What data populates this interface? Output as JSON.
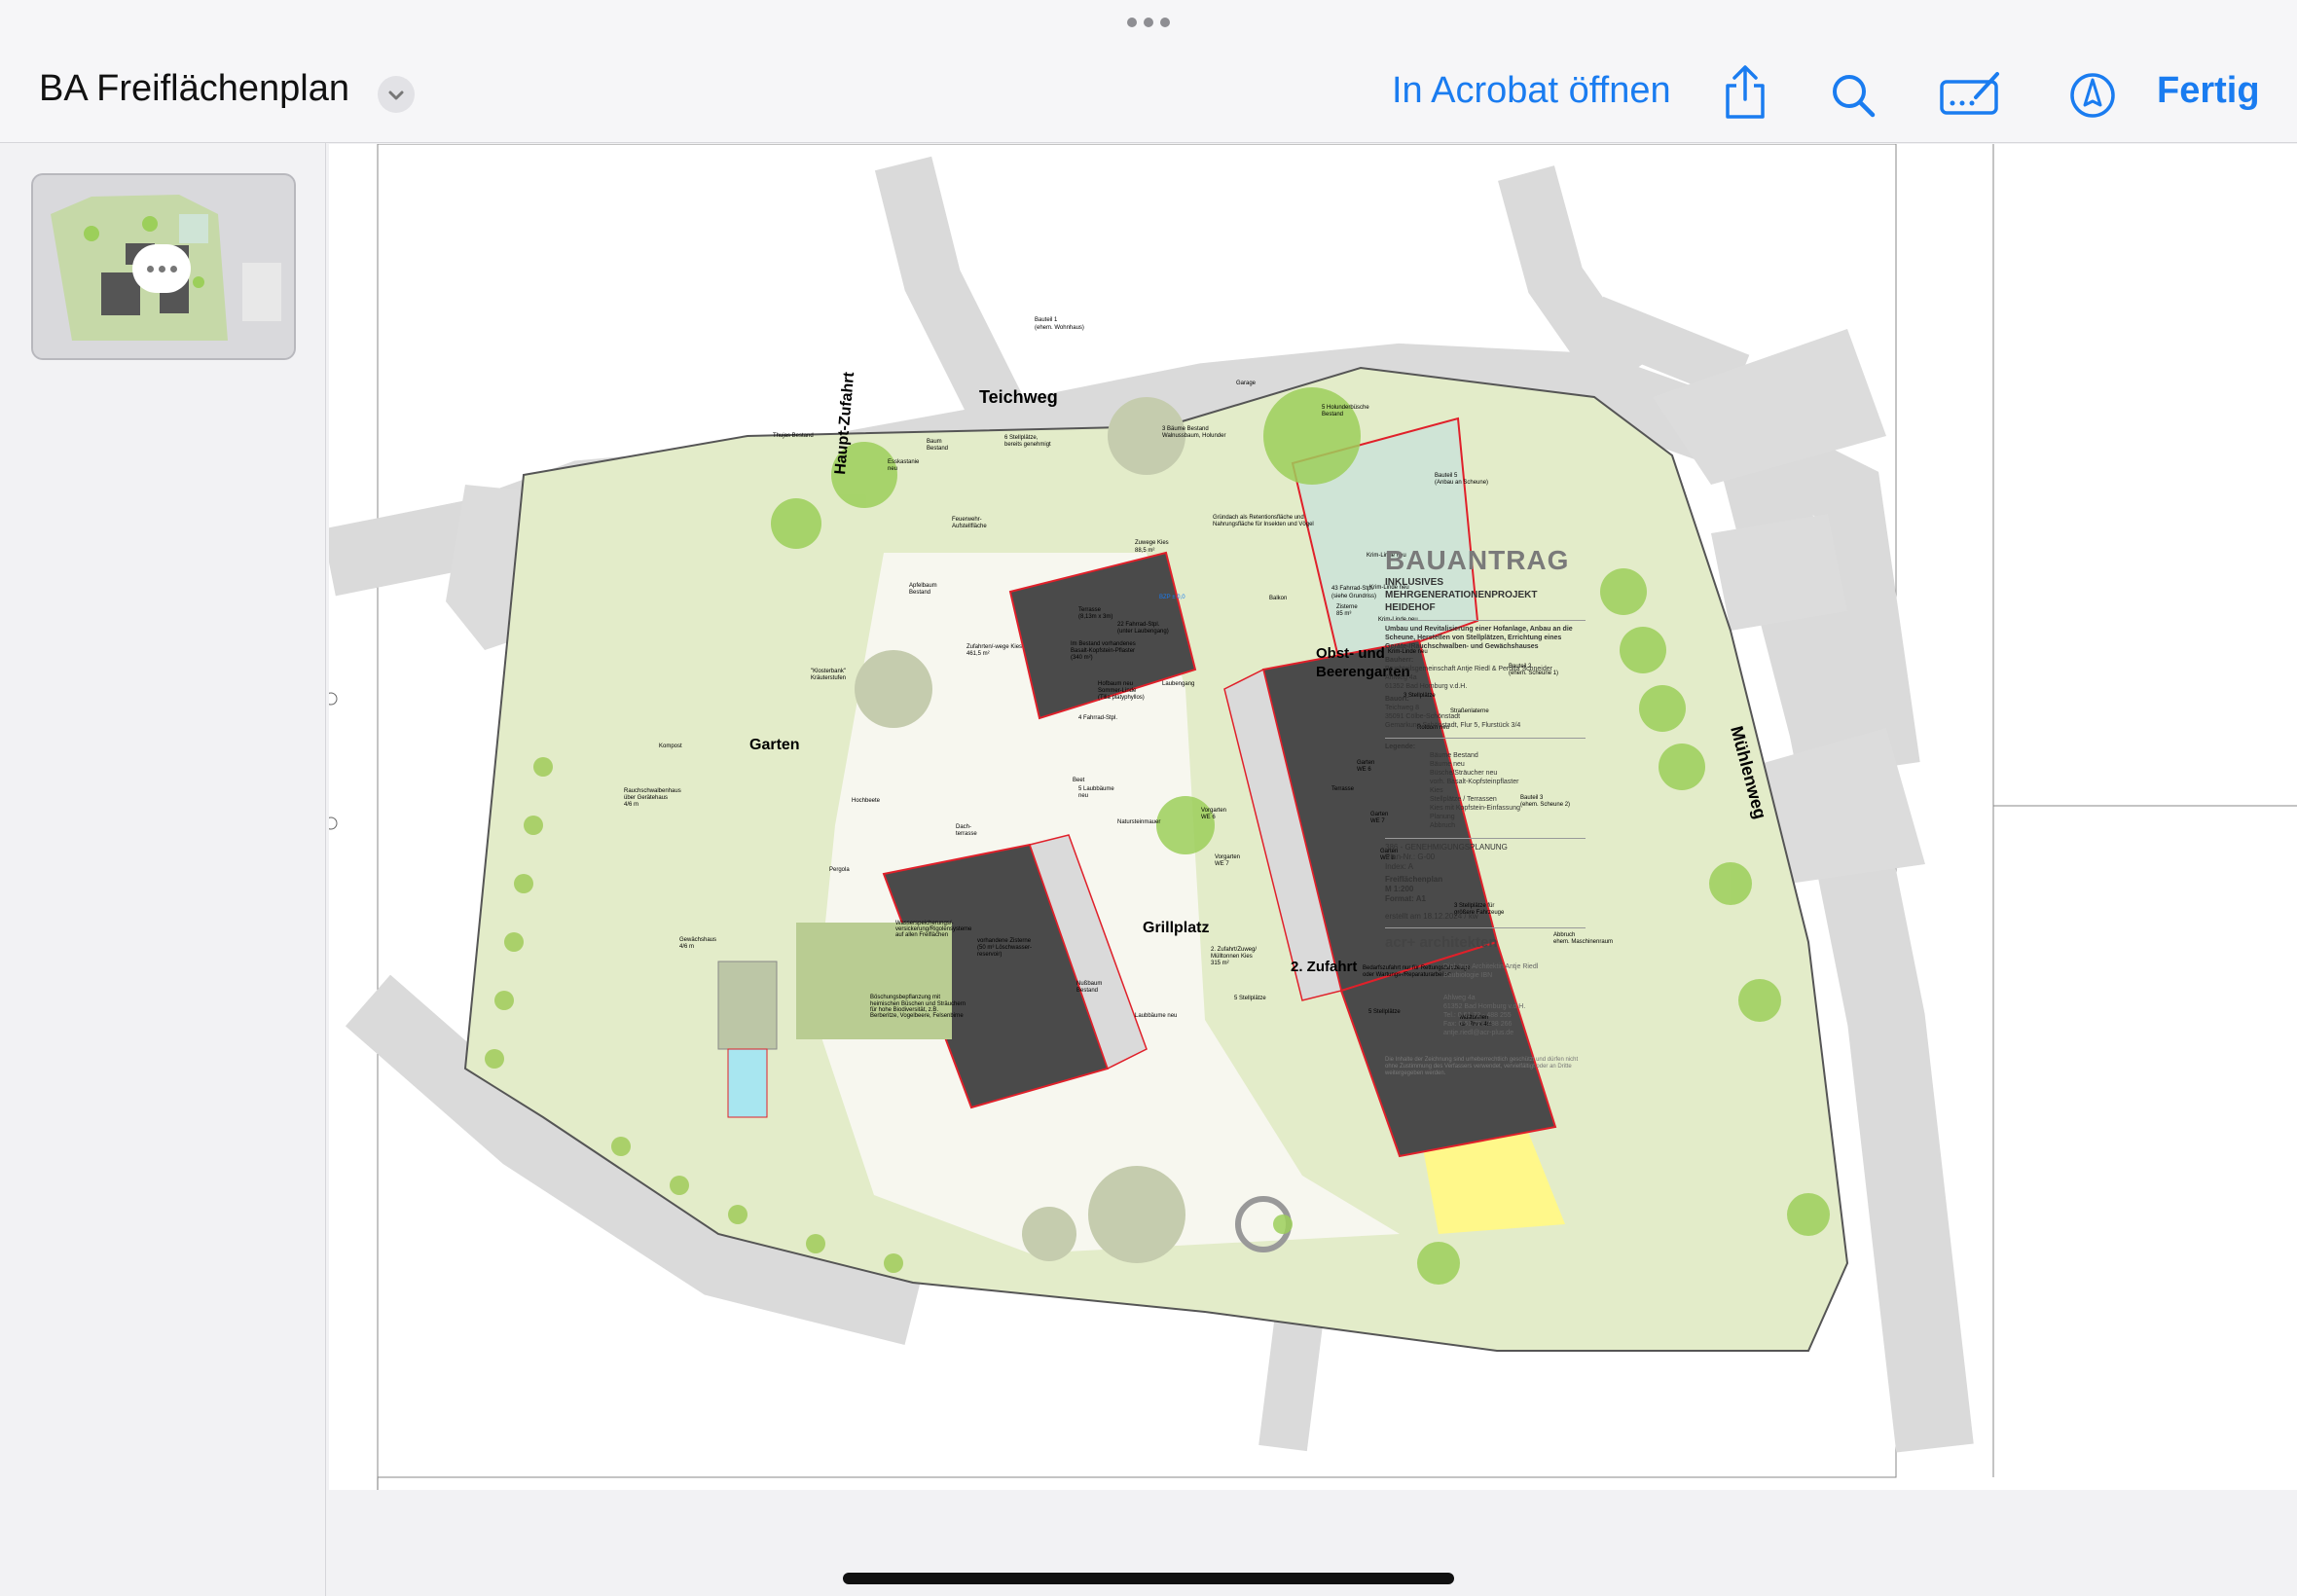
{
  "toolbar": {
    "title": "BA Freiflächenplan",
    "open_in_acrobat": "In Acrobat öffnen",
    "done": "Fertig"
  },
  "colors": {
    "accent": "#1a7cf0",
    "roof": "#4a4a4a",
    "lawn": "#e3ecc9",
    "tree": "#9ccf5a",
    "road": "#dcdcdc",
    "green_roof": "#cfe4d6",
    "gravel": "#fff88a",
    "planning_red": "#e0202a"
  },
  "icons": [
    "chevron-down-icon",
    "share-icon",
    "search-icon",
    "annotate-icon",
    "markup-pen-icon",
    "more-icon"
  ],
  "plan": {
    "labels": {
      "teichweg": "Teichweg",
      "haupt_zufahrt": "Haupt-Zufahrt",
      "muehlenweg": "Mühlenweg",
      "garten": "Garten",
      "obst_beeren_1": "Obst- und",
      "obst_beeren_2": "Beerengarten",
      "grillplatz": "Grillplatz",
      "zufahrt2": "2. Zufahrt",
      "bauteil1": "Bauteil 1",
      "bauteil1_sub": "(ehem. Wohnhaus)",
      "bauteil5": "Bauteil 5",
      "bauteil5_sub": "(Anbau an Scheune)",
      "bauteil2": "Bauteil 2",
      "bauteil2_sub": "(ehem. Scheune 1)",
      "bauteil3": "Bauteil 3",
      "bauteil3_sub": "(ehem. Scheune 2)",
      "stellplaetze6": "6 Stellplätze,",
      "stellplaetze6_sub": "bereits genehmigt",
      "feuerwehr": "Feuerwehr-",
      "feuerwehr_sub": "Aufstellfläche",
      "gruendach": "Gründach als Retentionsfläche und",
      "gruendach_sub": "Nahrungsfläche für Insekten und Vögel",
      "fahrrad43": "43 Fahrrad-Stpl.",
      "fahrrad43_sub": "(siehe Grundriss)",
      "zisterne": "Zisterne",
      "zisterne_sub": "85 m³",
      "zuwege": "Zuwege Kies",
      "zuwege_sub": "88,5 m²",
      "zufahrten": "Zufahrten/-wege Kies",
      "zufahrten_sub": "461,5 m²",
      "klosterbank": "\"Klosterbank\"",
      "klosterbank_sub": "Kräuterstufen",
      "kompost": "Kompost",
      "rauchschwalben": "Rauchschwalbenhaus",
      "rauchschwalben_sub": "über Gerätehaus",
      "rauchschwalben_sub2": "4/6 m",
      "gewaechshaus": "Gewächshaus",
      "gewaechshaus_sub": "4/6 m",
      "hochbeete": "Hochbeete",
      "pergola": "Pergola",
      "wasser": "Wasserspeicherungs/-",
      "wasser_sub": "versickerung/Rigolensysteme",
      "wasser_sub2": "auf allen Freiflächen",
      "zisterne_v": "vorhandene Zisterne",
      "zisterne_v_sub": "(50 m³ Löschwasser-",
      "zisterne_v_sub2": "reservoir)",
      "nussbaum": "Nußbaum",
      "nussbaum_sub": "Bestand",
      "boeschung": "Böschungsbepflanzung mit",
      "boeschung_sub": "heimischen Büschen und Sträuchern",
      "boeschung_sub2": "für hohe Biodiversität, z.B.",
      "boeschung_sub3": "Berberitze, Vogelbeere, Felsenbirne",
      "laubbaeume": "Laubbäume neu",
      "abbruch": "Abbruch",
      "abbruch_sub": "ehem. Maschinenraum",
      "muelltonnen": "Mülltonnen",
      "muelltonnen_sub": "ca. 7m x 4m",
      "bedarf": "Bedarfszufahrt nur für Rettungsfahrzeuge",
      "bedarf_sub": "oder Wartungs-/Reparaturarbeiten",
      "zuweg2": "2. Zufahrt/Zuweg/",
      "zuweg2_sub": "Mülltonnen Kies",
      "zuweg2_sub2": "315 m²",
      "krim1": "Krim-Linde neu",
      "krim2": "Krim-Linde neu",
      "krim3": "Krim-Linde neu",
      "krim4": "Krim-Linde neu",
      "rotdorn": "Rotdorn neu",
      "esskastanie": "Esskastanie",
      "esskastanie_sub": "neu",
      "apfelbaum": "Apfelbaum",
      "apfelbaum_sub": "Bestand",
      "thujas": "Thujas Bestand",
      "holunder": "5 Holunderbüsche",
      "holunder_sub": "Bestand",
      "bestand3": "3 Bäume Bestand",
      "bestand3_sub": "Walnussbaum, Holunder",
      "stpl5": "5 Stellplätze",
      "stpl3": "3 Stellplätze",
      "strassenlaterne": "Straßenlaterne",
      "fahrrad22": "22 Fahrrad-Stpl.",
      "fahrrad22_sub": "(unter Laubengang)",
      "fahrrad4": "4 Fahrrad-Stpl.",
      "pflaster": "Im Bestand vorhandenes",
      "pflaster_sub": "Basalt-Kopfstein-Pflaster",
      "pflaster_sub2": "(340 m²)",
      "hofbaum": "Hofbaum neu",
      "hofbaum_sub": "Sommer-Linde",
      "hofbaum_sub2": "(Tilia platyphyllos)",
      "laubengang": "Laubengang",
      "balkon": "Balkon",
      "terrasse": "Terrasse",
      "terrasse_main": "Terrasse",
      "terrasse_main_sub": "(8,13m x 3m)",
      "dachterrasse": "Dach-",
      "dachterrasse_sub": "terrasse",
      "beet": "Beet",
      "laubbaeume5": "5 Laubbäume",
      "laubbaeume5_sub": "neu",
      "naturstein": "Natursteinmauer",
      "garten6": "Garten",
      "garten6_sub": "WE 6",
      "garten7": "Garten",
      "garten7_sub": "WE 7",
      "garten8": "Garten",
      "garten8_sub": "WE 8",
      "vorgarten6": "Vorgarten",
      "vorgarten6_sub": "WE 6",
      "vorgarten7": "Vorgarten",
      "vorgarten7_sub": "WE 7",
      "bzp": "BZP ± 0,0",
      "stpl5b": "5 Stellplätze",
      "stpl3b": "3 Stellplätze für",
      "stpl3b_sub": "größere Fahrzeuge",
      "baum_bestand": "Baum",
      "baum_bestand_sub": "Bestand",
      "garage": "Garage"
    },
    "titleblock": {
      "heading": "BAUANTRAG",
      "sub1": "INKLUSIVES",
      "sub2": "MEHRGENERATIONENPROJEKT",
      "sub3": "HEIDEHOF",
      "desc": "Umbau und Revitalisierung einer Hofanlage, Anbau an die Scheune, Herstellen von Stellplätzen, Errichtung eines Geräte-/Rauchschwalben- und Gewächshauses",
      "bauherr_label": "Bauherr:",
      "bauherr": "Bruchteilsgemeinschaft Antje Riedl & Perdita Schneider",
      "bauherr_addr1": "Ahlweg 4a",
      "bauherr_addr2": "61352 Bad Homburg v.d.H.",
      "bauort_label": "Bauort:",
      "bauort1": "Teichweg 8",
      "bauort2": "35091 Cölbe-Schönstadt",
      "bauort3": "Gemarkung Schönstadt, Flur 5, Flurstück 3/4",
      "legende": "Legende:",
      "leg1": "Bäume Bestand",
      "leg2": "Bäume neu",
      "leg3": "Büsche/Sträucher neu",
      "leg4": "vorh. Basalt-Kopfsteinpflaster",
      "leg5": "Kies",
      "leg6": "Stellplätze / Terrassen",
      "leg6b": "Kies mit Kopfstein-Einfassung",
      "leg7": "Planung",
      "leg8": "Abbruch",
      "phase": "386 - GENEHMIGUNGSPLANUNG",
      "plannr": "Plan-Nr.: G-00",
      "index": "Index: A",
      "plantitle": "Freiflächenplan",
      "scale": "M 1:200",
      "format": "Format: A1",
      "date": "erstellt am 18.12.2024 / kw",
      "firm": "acr+ architekten",
      "arch1": "Dipl. Ing. Architektin Antje Riedl",
      "arch2": "Baubiologie IBN",
      "addr1": "Ahlweg 4a",
      "addr2": "61352 Bad Homburg v.d.H.",
      "tel": "Tel.: 0 61 72 - 488 255",
      "fax": "Fax: 0 61 72 - 488 266",
      "mail": "antje.riedl@acr-plus.de",
      "disclaimer": "Die Inhalte der Zeichnung sind urheberrechtlich geschützt und dürfen nicht ohne Zustimmung des Verfassers verwendet, vervielfältigt oder an Dritte weitergegeben werden."
    }
  }
}
